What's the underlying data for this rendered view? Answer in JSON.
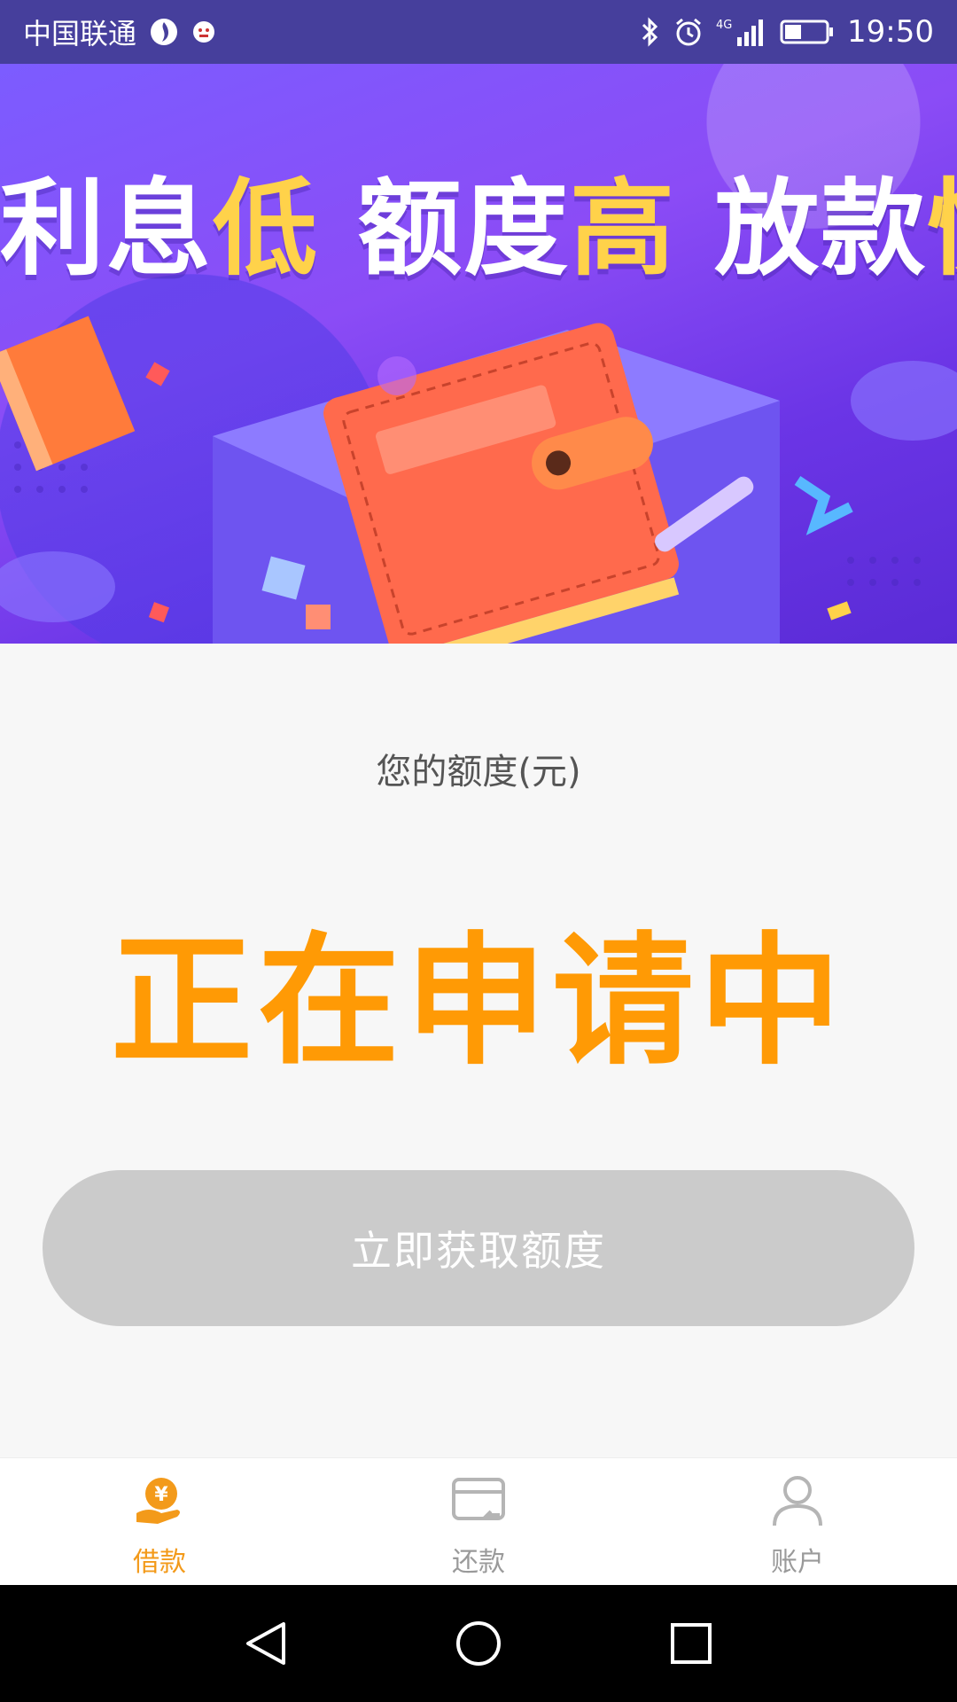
{
  "status_bar": {
    "carrier": "中国联通",
    "network": "4G",
    "time": "19:50",
    "icons": [
      "flame-icon",
      "app-notification-icon",
      "bluetooth-icon",
      "alarm-icon",
      "signal-icon",
      "battery-icon"
    ]
  },
  "banner": {
    "headline_parts": [
      "利息",
      "低",
      "额度",
      "高",
      "放款",
      "快"
    ]
  },
  "quota": {
    "label": "您的额度(元)",
    "status": "正在申请中"
  },
  "apply_button": {
    "label": "立即获取额度"
  },
  "tabs": [
    {
      "label": "借款",
      "icon": "loan-hand-yen-icon",
      "active": true
    },
    {
      "label": "还款",
      "icon": "repay-card-icon",
      "active": false
    },
    {
      "label": "账户",
      "icon": "user-icon",
      "active": false
    }
  ],
  "colors": {
    "accent": "#ff9a05",
    "tab_active": "#f39a1a",
    "tab_inactive": "#9a9a9a",
    "status_bar": "#463f9c",
    "button_disabled": "#cbcbcb"
  },
  "nav": {
    "icons": [
      "back-icon",
      "home-icon",
      "recents-icon"
    ]
  }
}
